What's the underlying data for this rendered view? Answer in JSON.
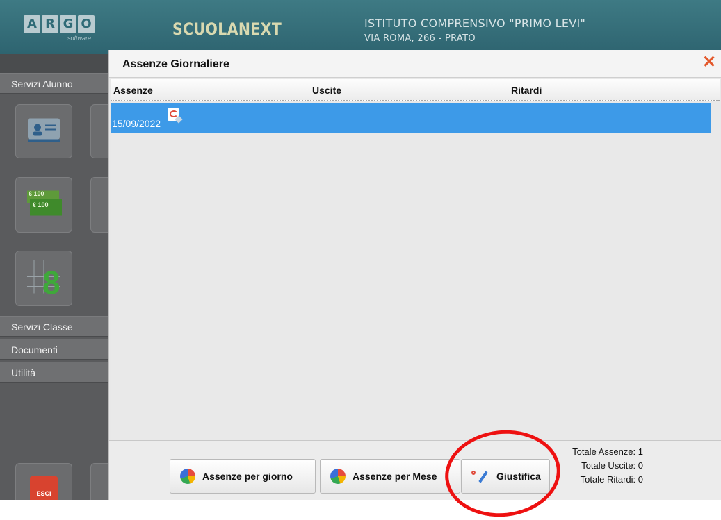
{
  "header": {
    "logo_letters": [
      "A",
      "R",
      "G",
      "O"
    ],
    "logo_sub": "software",
    "brand": "SCUOLANEXT",
    "school_name": "ISTITUTO COMPRENSIVO \"PRIMO LEVI\"",
    "school_address": "VIA ROMA, 266 - PRATO"
  },
  "sidebar": {
    "sections": [
      {
        "label": "Servizi Alunno"
      },
      {
        "label": "Servizi Classe"
      },
      {
        "label": "Documenti"
      },
      {
        "label": "Utilità"
      }
    ],
    "tiles": {
      "fees_icon_text": "€ 100",
      "grades_icon_text": "8",
      "exit_icon_text": "ESCI"
    }
  },
  "dialog": {
    "title": "Assenze Giornaliere",
    "close_icon": "close-icon",
    "table": {
      "columns": [
        "Assenze",
        "Uscite",
        "Ritardi"
      ],
      "rows": [
        {
          "assenze": "15/09/2022",
          "uscite": "",
          "ritardi": "",
          "selected": true,
          "icon": "justification-doc-icon"
        }
      ]
    },
    "footer": {
      "buttons": [
        {
          "label": "Assenze per giorno",
          "icon": "pie-chart-icon"
        },
        {
          "label": "Assenze per Mese",
          "icon": "pie-chart-icon"
        },
        {
          "label": "Giustifica",
          "icon": "pen-icon"
        }
      ],
      "totals": [
        "Totale Assenze: 1",
        "Totale Uscite: 0",
        "Totale Ritardi: 0"
      ]
    }
  },
  "colors": {
    "selection": "#3d9ae8",
    "annotation": "#ee1111",
    "header": "#2e6470"
  }
}
